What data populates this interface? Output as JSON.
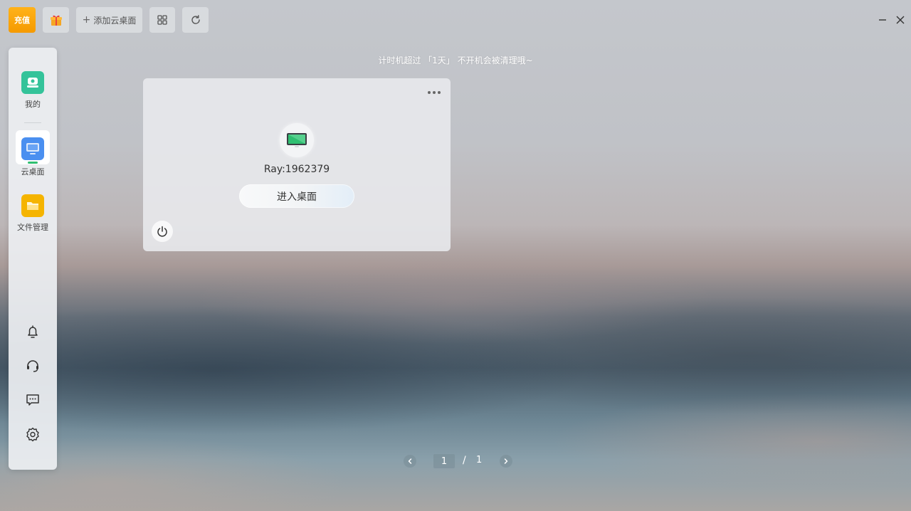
{
  "toolbar": {
    "recharge_label": "充值",
    "add_desktop_label": "添加云桌面",
    "add_icon": "plus-icon",
    "gift_icon": "gift-icon",
    "grid_icon": "grid-view-icon",
    "refresh_icon": "refresh-icon"
  },
  "window_controls": {
    "minimize_icon": "minimize-icon",
    "close_icon": "close-icon"
  },
  "sidebar": {
    "items": [
      {
        "label": "我的",
        "icon": "user-profile-icon",
        "color": "#2fbf8f"
      },
      {
        "label": "云桌面",
        "icon": "cloud-desktop-icon",
        "color": "#4a8ff0",
        "active": true
      },
      {
        "label": "文件管理",
        "icon": "folder-icon",
        "color": "#f5b400"
      }
    ],
    "tools": [
      {
        "icon": "bell-icon"
      },
      {
        "icon": "headset-icon"
      },
      {
        "icon": "chat-icon"
      },
      {
        "icon": "settings-icon"
      }
    ]
  },
  "notice": "计时机超过 「1天」 不开机会被清理哦~",
  "desktop_card": {
    "name": "Ray:1962379",
    "enter_label": "进入桌面",
    "status_color": "#2fbf71"
  },
  "pagination": {
    "current": "1",
    "separator": "/",
    "total": "1"
  }
}
